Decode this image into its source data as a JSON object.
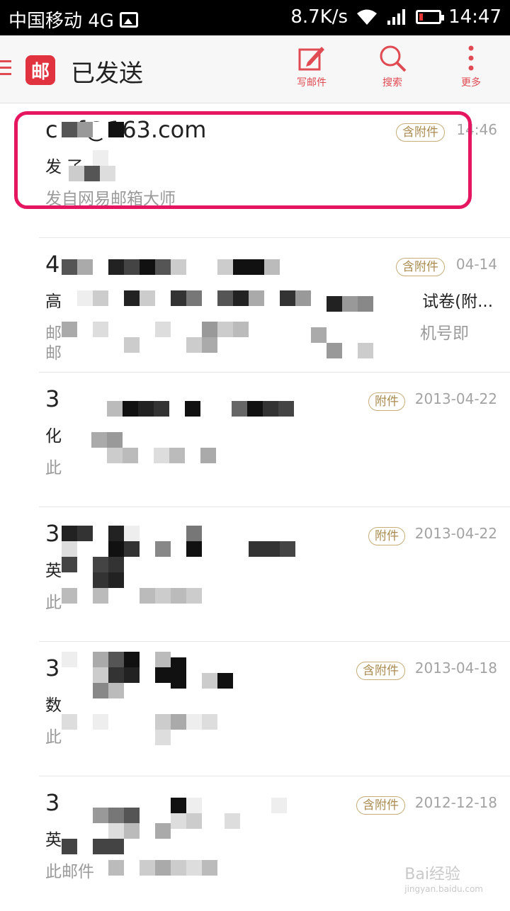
{
  "status_bar": {
    "carrier": "中国移动 4G",
    "speed": "8.7K/s",
    "time": "14:47"
  },
  "app_bar": {
    "logo_text": "邮",
    "title": "已发送",
    "actions": [
      {
        "label": "写邮件",
        "icon": "compose-icon"
      },
      {
        "label": "搜索",
        "icon": "search-icon"
      },
      {
        "label": "更多",
        "icon": "more-icon"
      }
    ]
  },
  "mails": [
    {
      "sender": "c      zf@163.com",
      "subject": "发    了。",
      "preview": "发自网易邮箱大师",
      "badge": "含附件",
      "date": "14:46"
    },
    {
      "sender": "4",
      "subject": "高",
      "subject_right": "试卷(附...",
      "preview": "邮",
      "preview_right": "机号即",
      "preview2": "邮",
      "badge": "含附件",
      "date": "04-14"
    },
    {
      "sender": "3",
      "subject": "化",
      "preview": "此",
      "badge": "附件",
      "date": "2013-04-22"
    },
    {
      "sender": "3",
      "subject": "英",
      "preview": "此",
      "badge": "附件",
      "date": "2013-04-22"
    },
    {
      "sender": "3",
      "subject": "数",
      "preview": "此",
      "badge": "含附件",
      "date": "2013-04-18"
    },
    {
      "sender": "3",
      "subject": "英",
      "preview": "此邮件",
      "badge": "含附件",
      "date": "2012-12-18"
    }
  ],
  "watermark": {
    "brand": "Bai经验",
    "url": "jingyan.baidu.com"
  },
  "colors": {
    "accent": "#e04a52",
    "highlight": "#e5155f",
    "badge": "#a98b4f"
  }
}
